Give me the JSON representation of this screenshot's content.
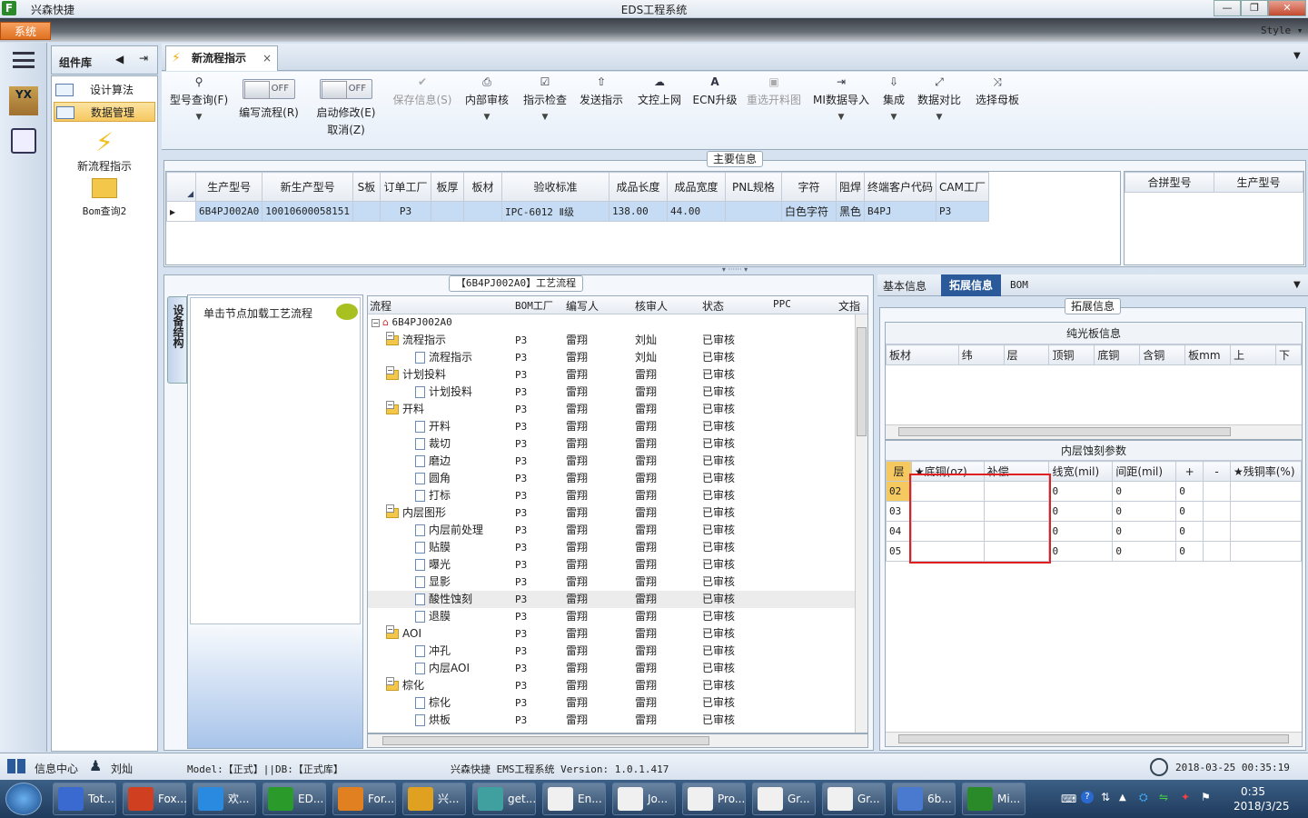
{
  "window": {
    "app_name": "兴森快捷",
    "title": "EDS工程系统"
  },
  "menubar": {
    "system_menu": "系统",
    "style_label": "Style"
  },
  "component_panel": {
    "header": "组件库",
    "items": [
      {
        "label": "设计算法",
        "selected": false
      },
      {
        "label": "数据管理",
        "selected": true
      }
    ],
    "big_items": [
      {
        "label": "新流程指示",
        "icon": "lightning-icon"
      },
      {
        "label": "Bom查询2",
        "icon": "folder-open-icon"
      }
    ]
  },
  "tabs": [
    {
      "label": "新流程指示",
      "closable": true
    }
  ],
  "ribbon": {
    "buttons": [
      {
        "label": "型号查询(F)",
        "icon": "search-icon",
        "disabled": false,
        "dropdown": true
      },
      {
        "label": "编写流程(R)",
        "toggle": "OFF"
      },
      {
        "label": "启动修改(E)",
        "sub": "取消(Z)",
        "toggle": "OFF"
      },
      {
        "label": "保存信息(S)",
        "icon": "check-icon",
        "disabled": true,
        "dropdown": false
      },
      {
        "label": "内部审核",
        "icon": "print-icon",
        "disabled": false,
        "dropdown": true
      },
      {
        "label": "指示检查",
        "icon": "checkbox-icon",
        "disabled": false,
        "dropdown": true
      },
      {
        "label": "发送指示",
        "icon": "upload-icon",
        "disabled": false,
        "dropdown": false
      },
      {
        "label": "文控上网",
        "icon": "cloud-upload-icon",
        "disabled": false,
        "dropdown": false
      },
      {
        "label": "ECN升级",
        "icon": "ecn-icon",
        "disabled": false,
        "dropdown": false
      },
      {
        "label": "重选开料图",
        "icon": "image-icon",
        "disabled": true,
        "dropdown": false
      },
      {
        "label": "MI数据导入",
        "icon": "import-icon",
        "disabled": false,
        "dropdown": true
      },
      {
        "label": "集成",
        "icon": "download-icon",
        "disabled": false,
        "dropdown": true
      },
      {
        "label": "数据对比",
        "icon": "compare-icon",
        "disabled": false,
        "dropdown": true
      },
      {
        "label": "选择母板",
        "icon": "shuffle-icon",
        "disabled": false,
        "dropdown": false
      }
    ]
  },
  "main_info": {
    "title": "主要信息",
    "columns": [
      "生产型号",
      "新生产型号",
      "S板",
      "订单工厂",
      "板厚",
      "板材",
      "验收标准",
      "成品长度",
      "成品宽度",
      "PNL规格",
      "字符",
      "阻焊",
      "终端客户代码",
      "CAM工厂"
    ],
    "rows": [
      [
        "6B4PJ002A0",
        "10010600058151",
        "",
        "P3",
        "",
        "",
        "IPC-6012 Ⅱ级",
        "138.00",
        "44.00",
        "",
        "白色字符",
        "黑色",
        "B4PJ",
        "P3"
      ]
    ],
    "side_columns": [
      "合拼型号",
      "生产型号"
    ]
  },
  "process": {
    "title": "【6B4PJ002A0】工艺流程",
    "side_tab": "设备结构",
    "hint": "单击节点加载工艺流程",
    "columns": [
      "流程",
      "BOM工厂",
      "编写人",
      "核审人",
      "状态",
      "PPC",
      "文指"
    ],
    "root": "6B4PJ002A0",
    "rows": [
      {
        "name": "流程指示",
        "level": 1,
        "type": "folder",
        "bom": "P3",
        "writer": "雷翔",
        "reviewer": "刘灿",
        "status": "已审核"
      },
      {
        "name": "流程指示",
        "level": 2,
        "type": "doc",
        "bom": "P3",
        "writer": "雷翔",
        "reviewer": "刘灿",
        "status": "已审核"
      },
      {
        "name": "计划投料",
        "level": 1,
        "type": "folder",
        "bom": "P3",
        "writer": "雷翔",
        "reviewer": "雷翔",
        "status": "已审核"
      },
      {
        "name": "计划投料",
        "level": 2,
        "type": "doc",
        "bom": "P3",
        "writer": "雷翔",
        "reviewer": "雷翔",
        "status": "已审核"
      },
      {
        "name": "开料",
        "level": 1,
        "type": "folder",
        "bom": "P3",
        "writer": "雷翔",
        "reviewer": "雷翔",
        "status": "已审核"
      },
      {
        "name": "开料",
        "level": 2,
        "type": "doc",
        "bom": "P3",
        "writer": "雷翔",
        "reviewer": "雷翔",
        "status": "已审核"
      },
      {
        "name": "裁切",
        "level": 2,
        "type": "doc",
        "bom": "P3",
        "writer": "雷翔",
        "reviewer": "雷翔",
        "status": "已审核"
      },
      {
        "name": "磨边",
        "level": 2,
        "type": "doc",
        "bom": "P3",
        "writer": "雷翔",
        "reviewer": "雷翔",
        "status": "已审核"
      },
      {
        "name": "圆角",
        "level": 2,
        "type": "doc",
        "bom": "P3",
        "writer": "雷翔",
        "reviewer": "雷翔",
        "status": "已审核"
      },
      {
        "name": "打标",
        "level": 2,
        "type": "doc",
        "bom": "P3",
        "writer": "雷翔",
        "reviewer": "雷翔",
        "status": "已审核"
      },
      {
        "name": "内层图形",
        "level": 1,
        "type": "folder",
        "bom": "P3",
        "writer": "雷翔",
        "reviewer": "雷翔",
        "status": "已审核"
      },
      {
        "name": "内层前处理",
        "level": 2,
        "type": "doc",
        "bom": "P3",
        "writer": "雷翔",
        "reviewer": "雷翔",
        "status": "已审核"
      },
      {
        "name": "贴膜",
        "level": 2,
        "type": "doc",
        "bom": "P3",
        "writer": "雷翔",
        "reviewer": "雷翔",
        "status": "已审核"
      },
      {
        "name": "曝光",
        "level": 2,
        "type": "doc",
        "bom": "P3",
        "writer": "雷翔",
        "reviewer": "雷翔",
        "status": "已审核"
      },
      {
        "name": "显影",
        "level": 2,
        "type": "doc",
        "bom": "P3",
        "writer": "雷翔",
        "reviewer": "雷翔",
        "status": "已审核"
      },
      {
        "name": "酸性蚀刻",
        "level": 2,
        "type": "doc",
        "bom": "P3",
        "writer": "雷翔",
        "reviewer": "雷翔",
        "status": "已审核",
        "highlight": true
      },
      {
        "name": "退膜",
        "level": 2,
        "type": "doc",
        "bom": "P3",
        "writer": "雷翔",
        "reviewer": "雷翔",
        "status": "已审核"
      },
      {
        "name": "AOI",
        "level": 1,
        "type": "folder",
        "bom": "P3",
        "writer": "雷翔",
        "reviewer": "雷翔",
        "status": "已审核"
      },
      {
        "name": "冲孔",
        "level": 2,
        "type": "doc",
        "bom": "P3",
        "writer": "雷翔",
        "reviewer": "雷翔",
        "status": "已审核"
      },
      {
        "name": "内层AOI",
        "level": 2,
        "type": "doc",
        "bom": "P3",
        "writer": "雷翔",
        "reviewer": "雷翔",
        "status": "已审核"
      },
      {
        "name": "棕化",
        "level": 1,
        "type": "folder",
        "bom": "P3",
        "writer": "雷翔",
        "reviewer": "雷翔",
        "status": "已审核"
      },
      {
        "name": "棕化",
        "level": 2,
        "type": "doc",
        "bom": "P3",
        "writer": "雷翔",
        "reviewer": "雷翔",
        "status": "已审核"
      },
      {
        "name": "烘板",
        "level": 2,
        "type": "doc",
        "bom": "P3",
        "writer": "雷翔",
        "reviewer": "雷翔",
        "status": "已审核"
      }
    ]
  },
  "right_panel": {
    "tabs": [
      "基本信息",
      "拓展信息",
      "BOM"
    ],
    "active_tab": "拓展信息",
    "title": "拓展信息",
    "bare_board": {
      "title": "纯光板信息",
      "columns": [
        "板材",
        "纬",
        "层",
        "顶铜",
        "底铜",
        "含铜",
        "板mm",
        "上",
        "下"
      ]
    },
    "inner_etch": {
      "title": "内层蚀刻参数",
      "columns": [
        "层",
        "★底铜(oz)",
        "补偿",
        "线宽(mil)",
        "间距(mil)",
        "+",
        "-",
        "★残铜率(%)"
      ],
      "rows": [
        [
          "02",
          "",
          "",
          "0",
          "0",
          "0",
          "",
          ""
        ],
        [
          "03",
          "",
          "",
          "0",
          "0",
          "0",
          "",
          ""
        ],
        [
          "04",
          "",
          "",
          "0",
          "0",
          "0",
          "",
          ""
        ],
        [
          "05",
          "",
          "",
          "0",
          "0",
          "0",
          "",
          ""
        ]
      ]
    }
  },
  "statusbar": {
    "info_center": "信息中心",
    "user": "刘灿",
    "model": "Model:【正式】||DB:【正式库】",
    "system": "兴森快捷 EMS工程系统 Version: 1.0.1.417",
    "datetime": "2018-03-25 00:35:19"
  },
  "taskbar": {
    "items": [
      "Tot...",
      "Fox...",
      "欢...",
      "ED...",
      "For...",
      "兴...",
      "get...",
      "En...",
      "Jo...",
      "Pro...",
      "Gr...",
      "Gr...",
      "6b...",
      "Mi..."
    ],
    "clock_time": "0:35",
    "clock_date": "2018/3/25"
  },
  "colors": {
    "accent": "#f08030",
    "selection": "#c6dcf4",
    "highlight_box": "#e02020",
    "taskbar": "#1e3a5c"
  }
}
